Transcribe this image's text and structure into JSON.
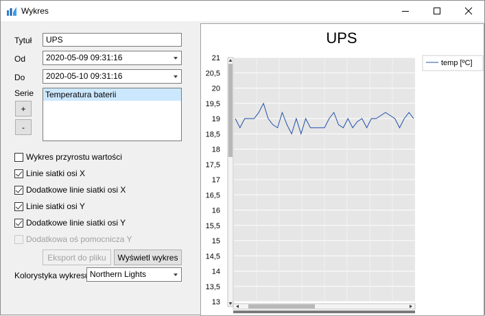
{
  "window": {
    "title": "Wykres",
    "icon": "chart-app-icon"
  },
  "form": {
    "title_label": "Tytuł",
    "title_value": "UPS",
    "from_label": "Od",
    "from_value": "2020-05-09 09:31:16",
    "to_label": "Do",
    "to_value": "2020-05-10 09:31:16",
    "series_label": "Serie",
    "series_items": [
      "Temperatura baterii"
    ],
    "add_button": "+",
    "remove_button": "-",
    "checkboxes": [
      {
        "label": "Wykres przyrostu wartości",
        "checked": false,
        "enabled": true
      },
      {
        "label": "Linie siatki osi X",
        "checked": true,
        "enabled": true
      },
      {
        "label": "Dodatkowe linie siatki osi X",
        "checked": true,
        "enabled": true
      },
      {
        "label": "Linie siatki osi Y",
        "checked": true,
        "enabled": true
      },
      {
        "label": "Dodatkowe linie siatki osi Y",
        "checked": true,
        "enabled": true
      },
      {
        "label": "Dodatkowa oś pomocnicza Y",
        "checked": false,
        "enabled": false
      }
    ],
    "export_button": "Eksport do pliku",
    "show_button": "Wyświetl wykres",
    "palette_label": "Kolorystyka wykresu:",
    "palette_value": "Northern Lights"
  },
  "chart_data": {
    "type": "line",
    "title": "UPS",
    "ylim": [
      13,
      21
    ],
    "y_ticks": [
      "21",
      "20,5",
      "20",
      "19,5",
      "19",
      "18,5",
      "18",
      "17,5",
      "17",
      "16,5",
      "16",
      "15,5",
      "15",
      "14,5",
      "14",
      "13,5",
      "13"
    ],
    "grid": true,
    "legend_position": "top-right",
    "line_color": "#1f4fa8",
    "series": [
      {
        "name": "temp [ºC]",
        "values": [
          19,
          18.7,
          19,
          19,
          19,
          19.2,
          19.5,
          19,
          18.8,
          18.7,
          19.2,
          18.8,
          18.5,
          19,
          18.5,
          19,
          18.7,
          18.7,
          18.7,
          18.7,
          19,
          19.2,
          18.8,
          18.7,
          19,
          18.7,
          18.9,
          19,
          18.7,
          19,
          19,
          19.1,
          19.2,
          19.1,
          19,
          18.7,
          19,
          19.2,
          19
        ]
      }
    ]
  }
}
